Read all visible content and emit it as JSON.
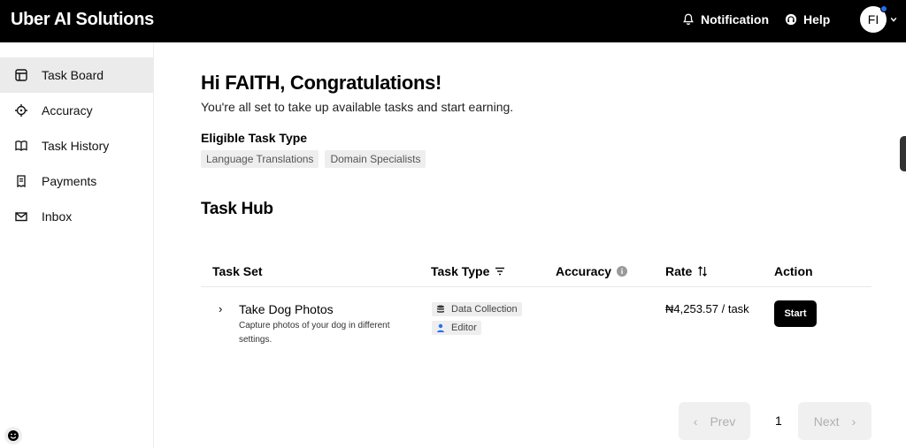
{
  "header": {
    "brand": "Uber AI Solutions",
    "notification_label": "Notification",
    "help_label": "Help",
    "avatar_initials": "FI"
  },
  "sidebar": {
    "items": [
      {
        "label": "Task Board",
        "icon": "board-icon",
        "active": true
      },
      {
        "label": "Accuracy",
        "icon": "target-icon"
      },
      {
        "label": "Task History",
        "icon": "book-icon"
      },
      {
        "label": "Payments",
        "icon": "receipt-icon"
      },
      {
        "label": "Inbox",
        "icon": "mail-icon"
      }
    ]
  },
  "main": {
    "greeting": "Hi FAITH, Congratulations!",
    "subtitle": "You're all set to take up available tasks and start earning.",
    "eligible_label": "Eligible Task Type",
    "eligible_types": [
      "Language Translations",
      "Domain Specialists"
    ],
    "hub_title": "Task Hub"
  },
  "table": {
    "columns": {
      "task_set": "Task Set",
      "task_type": "Task Type",
      "accuracy": "Accuracy",
      "rate": "Rate",
      "action": "Action"
    },
    "rows": [
      {
        "title": "Take Dog Photos",
        "description": "Capture photos of your dog in different settings.",
        "types": [
          "Data Collection",
          "Editor"
        ],
        "rate": "₦4,253.57 / task",
        "action": "Start"
      }
    ]
  },
  "pagination": {
    "prev_label": "Prev",
    "page": "1",
    "next_label": "Next"
  },
  "colors": {
    "header_bg": "#000000",
    "active_nav_bg": "#ebebeb",
    "chip_bg": "#eeeeee",
    "notification_dot": "#276ef1"
  }
}
